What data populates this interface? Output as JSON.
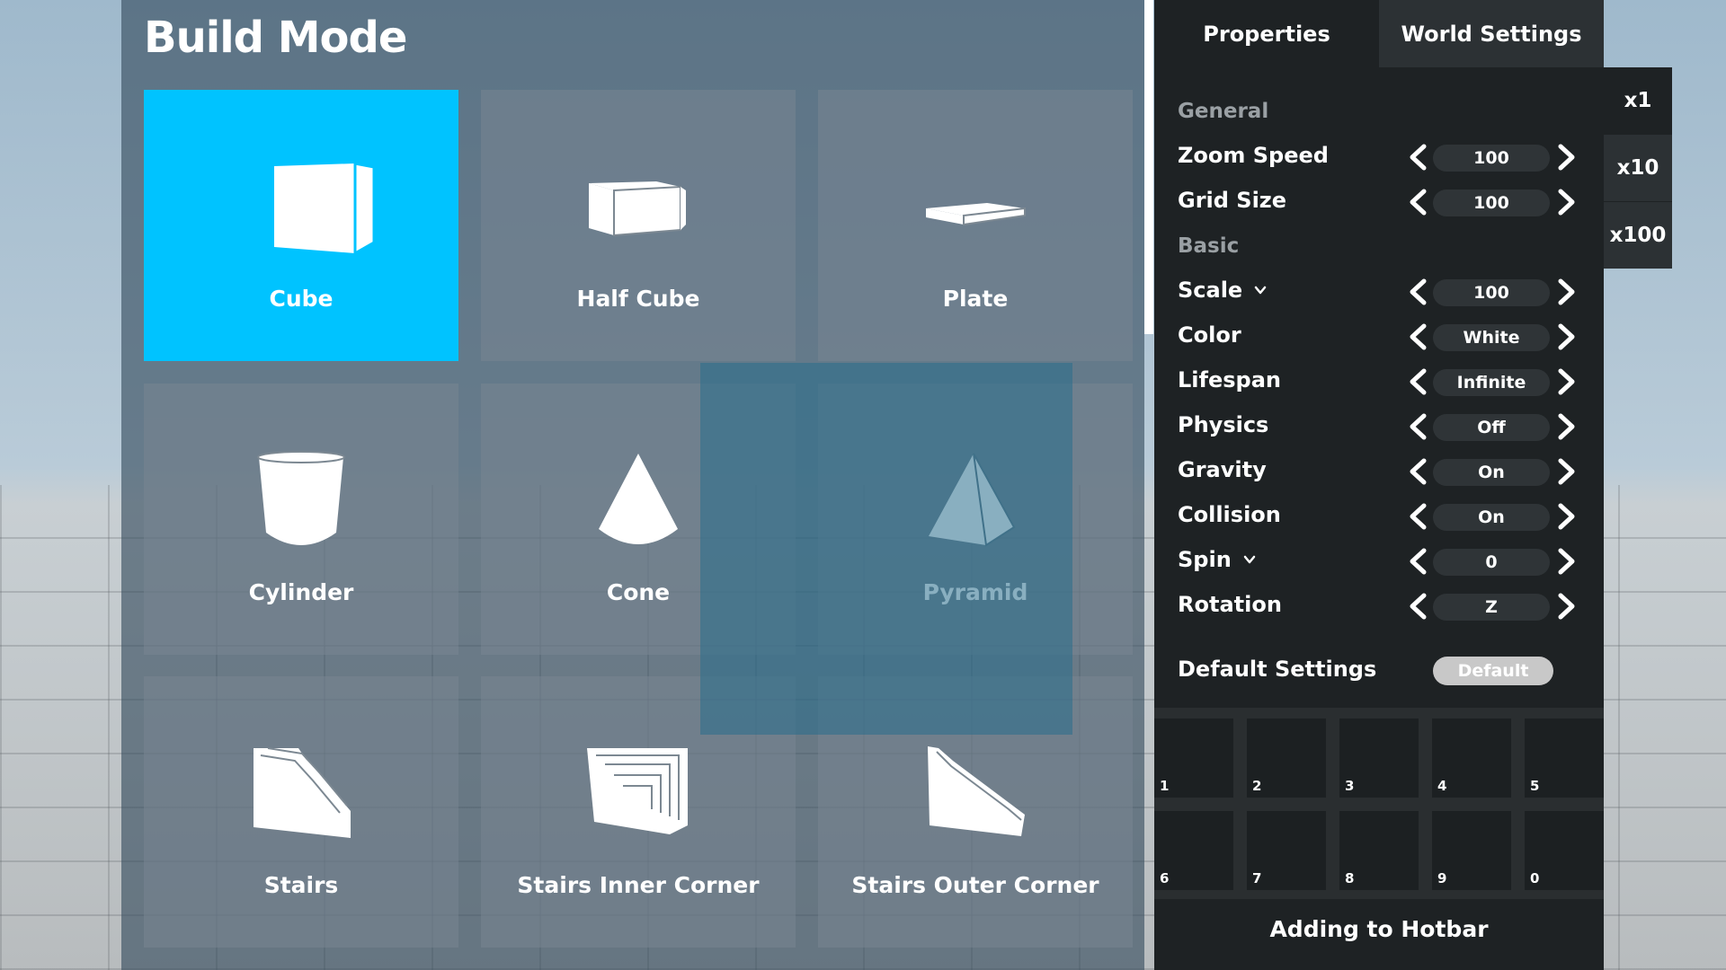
{
  "build_panel": {
    "title": "Build Mode",
    "tiles": [
      {
        "label": "Cube",
        "icon": "cube-icon",
        "selected": true
      },
      {
        "label": "Half Cube",
        "icon": "half-cube-icon",
        "selected": false
      },
      {
        "label": "Plate",
        "icon": "plate-icon",
        "selected": false
      },
      {
        "label": "Cylinder",
        "icon": "cylinder-icon",
        "selected": false
      },
      {
        "label": "Cone",
        "icon": "cone-icon",
        "selected": false
      },
      {
        "label": "Pyramid",
        "icon": "pyramid-icon",
        "selected": false
      },
      {
        "label": "Stairs",
        "icon": "stairs-icon",
        "selected": false
      },
      {
        "label": "Stairs Inner Corner",
        "icon": "stairs-inner-corner-icon",
        "selected": false
      },
      {
        "label": "Stairs Outer Corner",
        "icon": "stairs-outer-corner-icon",
        "selected": false
      }
    ]
  },
  "tabs": [
    {
      "label": "Properties",
      "active": true
    },
    {
      "label": "World Settings",
      "active": false
    }
  ],
  "properties": {
    "section_general": "General",
    "section_basic": "Basic",
    "zoom_speed": {
      "label": "Zoom Speed",
      "value": "100"
    },
    "grid_size": {
      "label": "Grid Size",
      "value": "100"
    },
    "scale": {
      "label": "Scale",
      "value": "100"
    },
    "color": {
      "label": "Color",
      "value": "White"
    },
    "lifespan": {
      "label": "Lifespan",
      "value": "Infinite"
    },
    "physics": {
      "label": "Physics",
      "value": "Off"
    },
    "gravity": {
      "label": "Gravity",
      "value": "On"
    },
    "collision": {
      "label": "Collision",
      "value": "On"
    },
    "spin": {
      "label": "Spin",
      "value": "0"
    },
    "rotation": {
      "label": "Rotation",
      "value": "Z"
    },
    "default_settings_label": "Default Settings",
    "default_button": "Default"
  },
  "multipliers": [
    {
      "label": "x1",
      "active": true
    },
    {
      "label": "x10",
      "active": false
    },
    {
      "label": "x100",
      "active": false
    }
  ],
  "hotbar": {
    "slots": [
      "1",
      "2",
      "3",
      "4",
      "5",
      "6",
      "7",
      "8",
      "9",
      "0"
    ],
    "caption": "Adding to Hotbar"
  },
  "colors": {
    "accent": "#00c3ff",
    "panel_dark": "#1e2224"
  }
}
